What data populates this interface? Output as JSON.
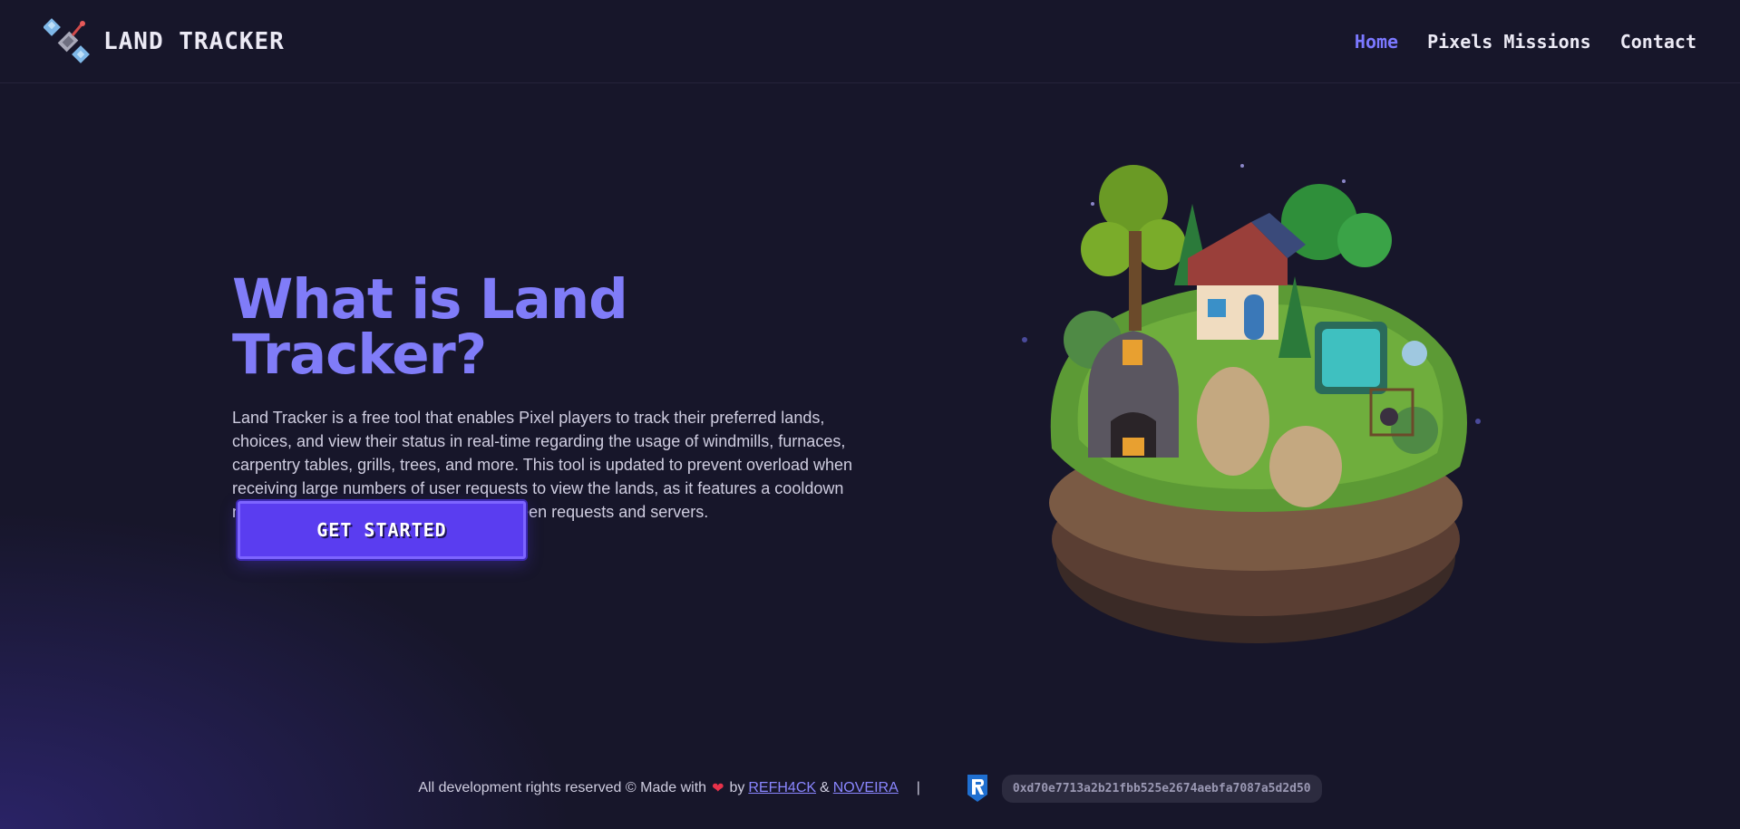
{
  "nav": {
    "brand": "LAND TRACKER",
    "links": [
      {
        "label": "Home",
        "active": true
      },
      {
        "label": "Pixels Missions",
        "active": false
      },
      {
        "label": "Contact",
        "active": false
      }
    ],
    "logo_icon": "satellite-icon"
  },
  "hero": {
    "title": "What is Land Tracker?",
    "description": "Land Tracker is a free tool that enables Pixel players to track their preferred lands, choices, and view their status in real-time regarding the usage of windmills, furnaces, carpentry tables, grills, trees, and more. This tool is updated to prevent overload when receiving large numbers of user requests to view the lands, as it features a cooldown mechanism that maintains stability between requests and servers.",
    "cta_label": "GET STARTED",
    "image_icon": "floating-island-illustration"
  },
  "footer": {
    "rights_text": "All development rights reserved © Made with",
    "by_text": "by",
    "author1": "REFH4CK",
    "and_text": "&",
    "author2": "NOVEIRA",
    "separator": "|",
    "ronin_icon": "ronin-icon",
    "wallet_address": "0xd70e7713a2b21fbb525e2674aebfa7087a5d2d50"
  },
  "colors": {
    "background": "#17162a",
    "accent": "#807cf8",
    "button": "#5a3df0",
    "heart": "#e8324a"
  }
}
